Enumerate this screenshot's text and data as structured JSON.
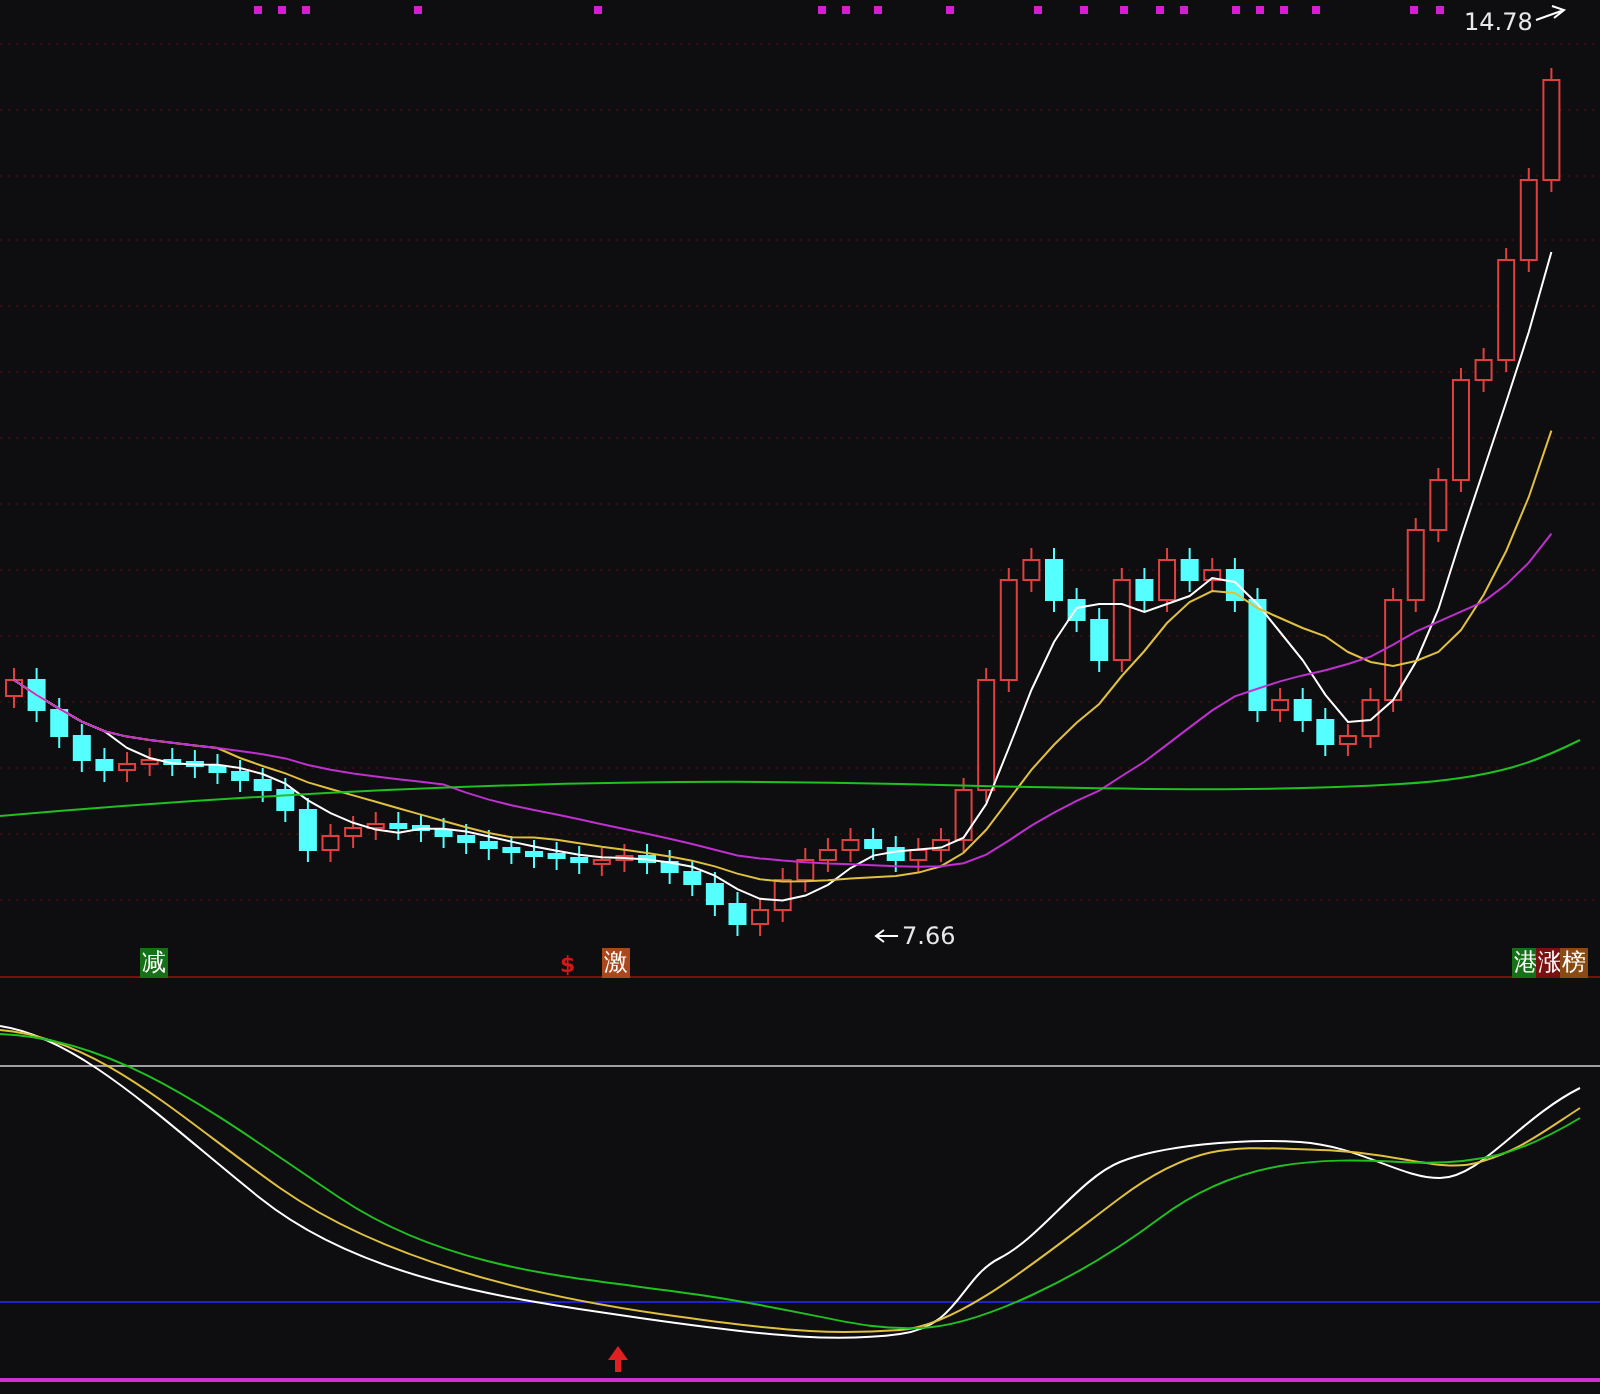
{
  "price_panel": {
    "high_label": "14.78",
    "low_label": "7.66",
    "signals": [
      {
        "kind": "tag",
        "text": "减",
        "color": "#167016"
      },
      {
        "kind": "glyph",
        "text": "$",
        "color": "#d01818"
      },
      {
        "kind": "tag",
        "text": "激",
        "color": "#a8481c"
      },
      {
        "kind": "tag",
        "text": "港",
        "color": "#167016"
      },
      {
        "kind": "tag",
        "text": "涨",
        "color": "#7a1010"
      },
      {
        "kind": "tag",
        "text": "榜",
        "color": "#8a4a14"
      }
    ]
  }
}
